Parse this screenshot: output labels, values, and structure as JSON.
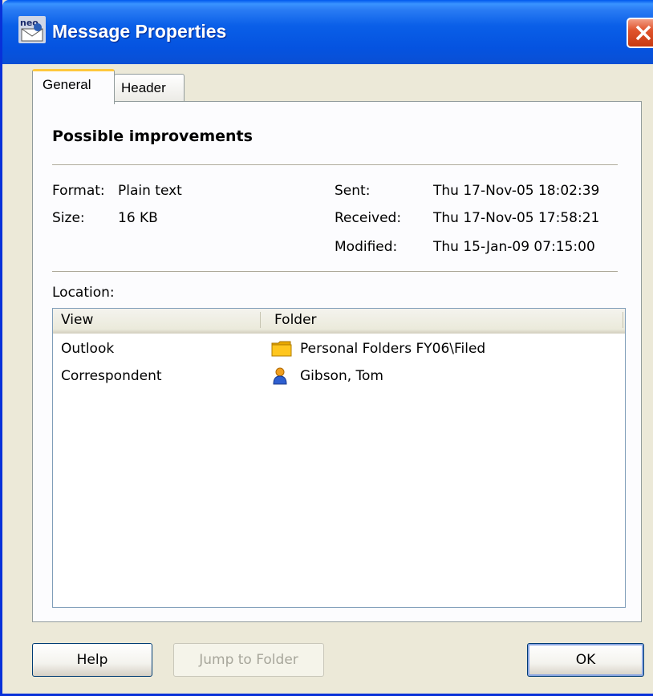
{
  "window": {
    "title": "Message Properties",
    "icon_label": "neo",
    "accent_color": "#0553e0",
    "close_color": "#e0542c"
  },
  "tabs": [
    {
      "label": "General",
      "selected": true
    },
    {
      "label": "Header",
      "selected": false
    }
  ],
  "general": {
    "subject": "Possible improvements",
    "format_label": "Format:",
    "format_value": "Plain text",
    "size_label": "Size:",
    "size_value": "16 KB",
    "sent_label": "Sent:",
    "sent_value": "Thu 17-Nov-05 18:02:39",
    "received_label": "Received:",
    "received_value": "Thu 17-Nov-05 17:58:21",
    "modified_label": "Modified:",
    "modified_value": "Thu 15-Jan-09 07:15:00",
    "location_label": "Location:"
  },
  "location_table": {
    "columns": [
      "View",
      "Folder"
    ],
    "rows": [
      {
        "view": "Outlook",
        "folder": "Personal Folders FY06\\Filed",
        "icon": "folder-icon"
      },
      {
        "view": "Correspondent",
        "folder": "Gibson, Tom",
        "icon": "person-icon"
      }
    ]
  },
  "buttons": {
    "help": "Help",
    "jump": "Jump to Folder",
    "ok": "OK"
  }
}
